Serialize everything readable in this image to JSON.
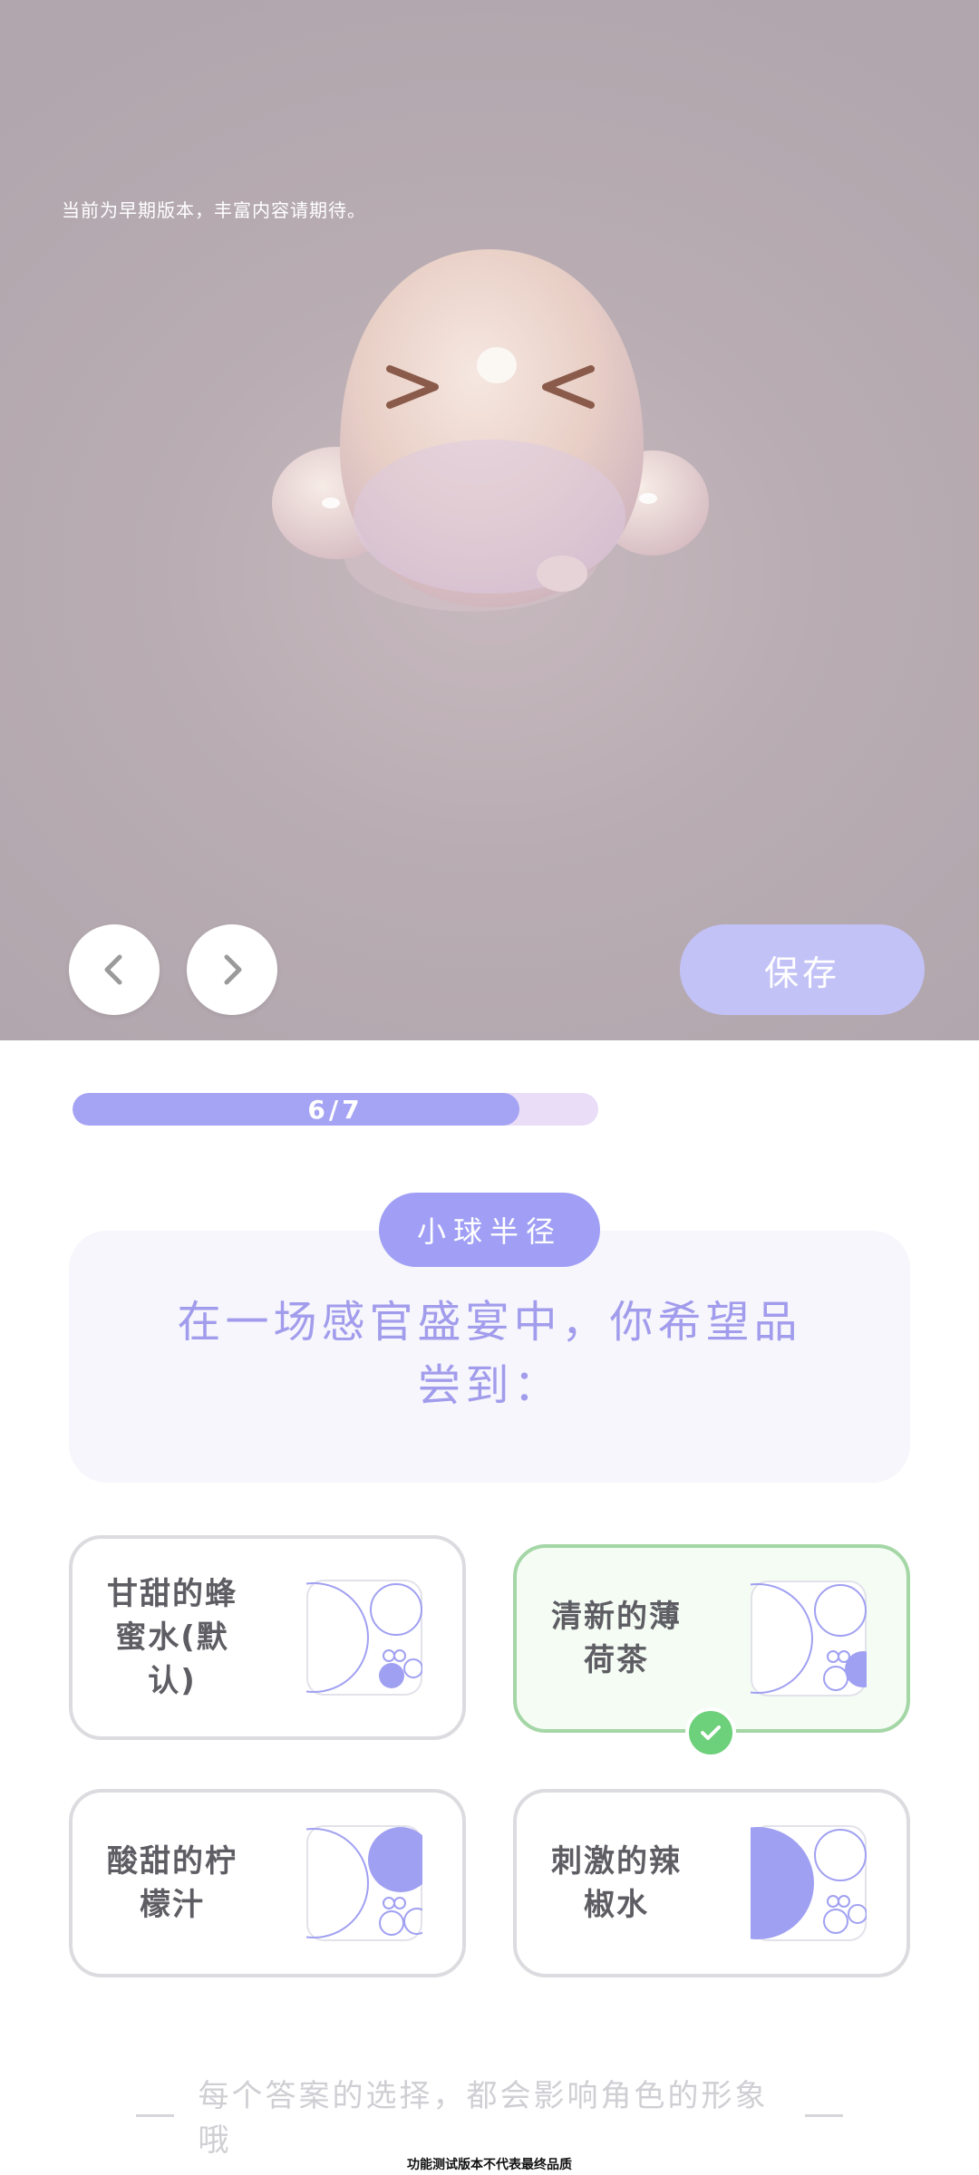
{
  "preview": {
    "notice": "当前为早期版本，丰富内容请期待。",
    "save_label": "保存"
  },
  "progress": {
    "text": "6/7",
    "current": 6,
    "total": 7,
    "fill_fraction": 0.85
  },
  "question": {
    "tag": "小球半径",
    "text": "在一场感官盛宴中，你希望品尝到："
  },
  "options": [
    {
      "label": "甘甜的蜂蜜水(默认)",
      "selected": false,
      "icon": "circle-pattern-small-icon"
    },
    {
      "label": "清新的薄荷茶",
      "selected": true,
      "icon": "circle-pattern-medium-icon"
    },
    {
      "label": "酸甜的柠檬汁",
      "selected": false,
      "icon": "circle-pattern-large-icon"
    },
    {
      "label": "刺激的辣椒水",
      "selected": false,
      "icon": "circle-pattern-xlarge-icon"
    }
  ],
  "footer": {
    "hint": "每个答案的选择，都会影响角色的形象哦",
    "disclaimer": "功能测试版本不代表最终品质"
  },
  "colors": {
    "accent": "#a09ff5",
    "save_button": "#c2c2f6",
    "selected_border": "#a4d6a6",
    "check": "#6dd07a",
    "question_text": "#a29cec"
  }
}
